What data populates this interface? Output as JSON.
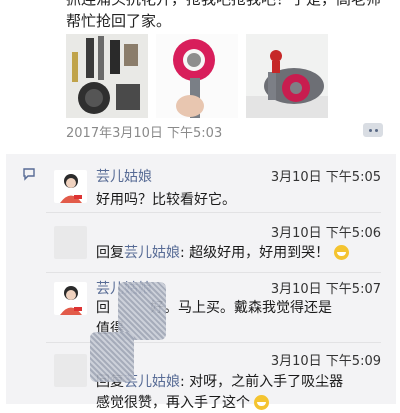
{
  "post": {
    "text": "抓连涌头抗花开，抢我吧抢我吧！于是，高老师帮忙抢回了家。",
    "timestamp": "2017年3月10日 下午5:03",
    "photos": [
      "dyson-products-photo",
      "hair-dryer-in-hand-photo",
      "hair-dryer-with-figurine-photo"
    ]
  },
  "comments": [
    {
      "name": "芸儿姑娘",
      "time": "3月10日 下午5:05",
      "text": "好用吗？比较看好它。"
    },
    {
      "time": "3月10日 下午5:06",
      "reply_word": "回复",
      "reply_target": "芸儿姑娘",
      "text": ": 超级好用，好用到哭！"
    },
    {
      "name": "芸儿姑娘",
      "time": "3月10日 下午5:07",
      "line1_start": "回",
      "line1_end": "好。马上买。戴森我觉得还是",
      "line2": "值得"
    },
    {
      "time": "3月10日 下午5:09",
      "reply_word": "回复",
      "reply_target": "芸儿姑娘",
      "text": ": 对呀，之前入手了吸尘器",
      "line2": "感觉很赞，再入手了这个"
    }
  ],
  "colors": {
    "name_link": "#576b95",
    "panel_bg": "#f3f3f5"
  }
}
